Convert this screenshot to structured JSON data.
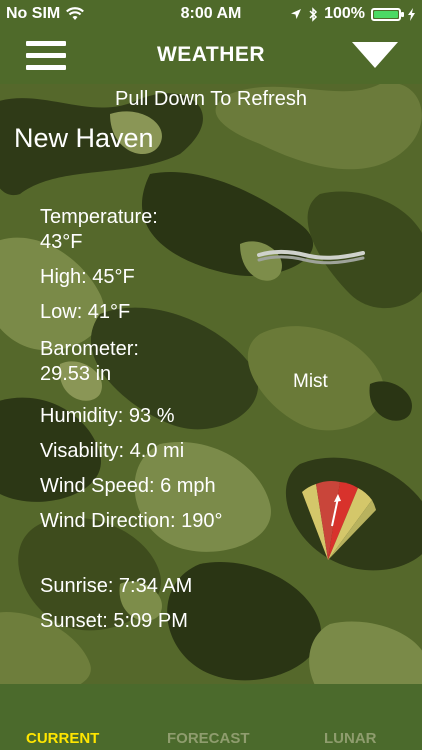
{
  "status_bar": {
    "carrier": "No SIM",
    "time": "8:00 AM",
    "battery": "100%",
    "battery_level": 1.0
  },
  "nav": {
    "title": "WEATHER"
  },
  "refresh_hint": "Pull Down To Refresh",
  "city": "New Haven",
  "weather": {
    "temperature_label": "Temperature:",
    "temperature_value": "43°F",
    "high": "High: 45°F",
    "low": "Low: 41°F",
    "barometer_label": "Barometer:",
    "barometer_value": "29.53 in",
    "humidity": "Humidity: 93 %",
    "visibility": "Visability: 4.0 mi",
    "wind_speed": "Wind Speed: 6 mph",
    "wind_direction": "Wind Direction: 190°",
    "sunrise": "Sunrise: 7:34 AM",
    "sunset": "Sunset: 5:09 PM",
    "condition": "Mist"
  },
  "icons": {
    "menu": "hamburger-menu-icon",
    "dropdown": "triangle-down-icon",
    "condition": "mist-icon",
    "wind": "wind-direction-fan-icon",
    "wifi": "wifi-icon",
    "location": "location-arrow-icon",
    "bluetooth": "bluetooth-icon",
    "charging": "charging-bolt-icon"
  },
  "tabs": [
    {
      "label": "CURRENT",
      "active": true
    },
    {
      "label": "FORECAST",
      "active": false
    },
    {
      "label": "LUNAR",
      "active": false
    }
  ],
  "colors": {
    "bar_green": "#4f6a2a",
    "active_tab": "#ffe600",
    "inactive_tab": "#8f9d6e"
  }
}
